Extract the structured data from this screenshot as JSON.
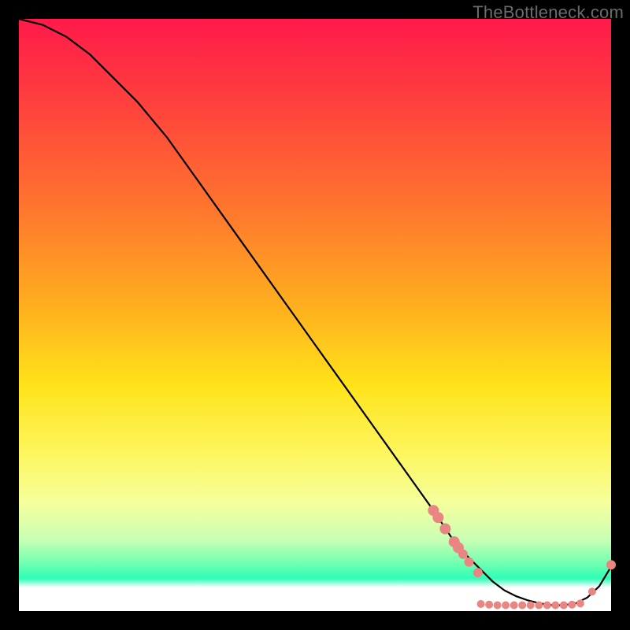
{
  "watermark": "TheBottleneck.com",
  "chart_data": {
    "type": "line",
    "title": "",
    "xlabel": "",
    "ylabel": "",
    "xlim": [
      0,
      100
    ],
    "ylim": [
      0,
      100
    ],
    "series": [
      {
        "name": "bottleneck-curve",
        "x": [
          0,
          4,
          8,
          12,
          16,
          20,
          25,
          30,
          35,
          40,
          45,
          50,
          55,
          60,
          65,
          70,
          72,
          74,
          76,
          78,
          80,
          82,
          84,
          86,
          88,
          90,
          92,
          94,
          96,
          98,
          100
        ],
        "y": [
          100,
          99,
          97,
          94,
          90,
          86,
          80,
          73,
          66,
          59,
          52,
          45,
          38,
          31,
          24,
          17,
          14,
          11,
          9,
          7,
          5,
          3.5,
          2.5,
          1.8,
          1.3,
          1.0,
          1.0,
          1.3,
          2.3,
          4.2,
          7.5
        ]
      }
    ],
    "markers": [
      {
        "x": 70.0,
        "y": 17.0,
        "r": 7
      },
      {
        "x": 70.8,
        "y": 15.8,
        "r": 7
      },
      {
        "x": 72.0,
        "y": 13.9,
        "r": 7
      },
      {
        "x": 73.5,
        "y": 11.7,
        "r": 7
      },
      {
        "x": 74.2,
        "y": 10.7,
        "r": 7
      },
      {
        "x": 75.0,
        "y": 9.6,
        "r": 6
      },
      {
        "x": 76.0,
        "y": 8.3,
        "r": 6
      },
      {
        "x": 77.5,
        "y": 6.5,
        "r": 6
      },
      {
        "x": 78.0,
        "y": 1.2,
        "r": 5
      },
      {
        "x": 79.4,
        "y": 1.1,
        "r": 5
      },
      {
        "x": 80.8,
        "y": 1.0,
        "r": 5
      },
      {
        "x": 82.2,
        "y": 1.0,
        "r": 5
      },
      {
        "x": 83.6,
        "y": 1.0,
        "r": 5
      },
      {
        "x": 85.0,
        "y": 1.0,
        "r": 5
      },
      {
        "x": 86.4,
        "y": 1.0,
        "r": 5
      },
      {
        "x": 87.8,
        "y": 1.0,
        "r": 5
      },
      {
        "x": 89.2,
        "y": 1.0,
        "r": 5
      },
      {
        "x": 90.6,
        "y": 1.0,
        "r": 5
      },
      {
        "x": 92.0,
        "y": 1.0,
        "r": 5
      },
      {
        "x": 93.4,
        "y": 1.1,
        "r": 5
      },
      {
        "x": 94.8,
        "y": 1.3,
        "r": 5
      },
      {
        "x": 96.8,
        "y": 3.3,
        "r": 5
      },
      {
        "x": 100.0,
        "y": 7.8,
        "r": 6
      }
    ],
    "colors": {
      "curve": "#000000",
      "marker": "#e98683",
      "gradient_top": "#ff1a4b",
      "gradient_bottom": "#ffffff"
    }
  }
}
